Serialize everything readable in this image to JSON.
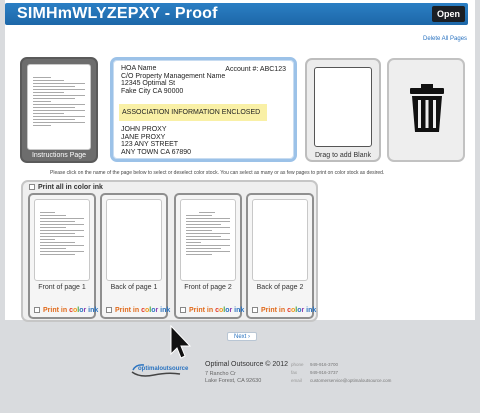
{
  "header": {
    "title": "SIMHmWLYZEPXY - Proof",
    "open_label": "Open"
  },
  "toolbar": {
    "delete_all_label": "Delete All Pages"
  },
  "instructions_page": {
    "caption": "Instructions Page"
  },
  "address_block": {
    "lines": [
      "HOA Name",
      "C/O Property Management Name",
      "12345 Optimal St",
      "Fake City CA 90000"
    ],
    "account": "Account #: ABC123",
    "highlight": "ASSOCIATION INFORMATION ENCLOSED",
    "recipient": [
      "JOHN PROXY",
      "JANE PROXY",
      "123 ANY STREET",
      "ANY TOWN CA 67890"
    ]
  },
  "blank_drop": {
    "caption": "Drag to add Blank"
  },
  "trash": {
    "icon": "trash-icon"
  },
  "instruction_text": "Please click on the name of the page below to select or deselect color stock. You can select as many or as few pages to print on color stock as desired.",
  "color_panel": {
    "print_all_label": "Print all in color ink",
    "print_in_label": "Print in ",
    "color_word": [
      "c",
      "o",
      "l",
      "o",
      "r"
    ],
    "ink_word": " ink",
    "color_letter_colors": [
      "#e23b2e",
      "#f29b1d",
      "#3fa33a",
      "#2a73c0",
      "#8e3fb0"
    ],
    "pages": [
      {
        "label": "Front of page 1"
      },
      {
        "label": "Back of page 1"
      },
      {
        "label": "Front of page 2"
      },
      {
        "label": "Back of page 2"
      }
    ]
  },
  "pager": {
    "next_label": "Next"
  },
  "footer": {
    "logo_text": "optimaloutsource",
    "company": "Optimal Outsource © 2012",
    "address": [
      "7 Rancho Cr",
      "Lake Forest, CA 92630"
    ],
    "contacts": [
      {
        "label": "phone",
        "value": "949-916-3700"
      },
      {
        "label": "fax",
        "value": "949-916-3737"
      },
      {
        "label": "email",
        "value": "customerservice@optimaloutsource.com"
      }
    ]
  }
}
